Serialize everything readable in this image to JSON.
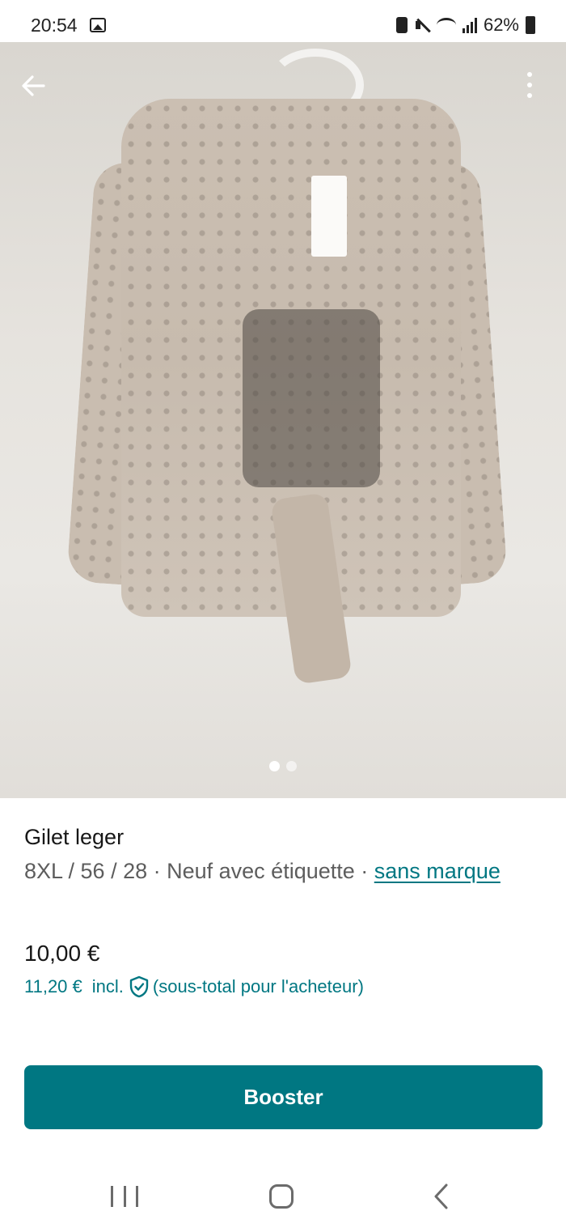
{
  "status_bar": {
    "time": "20:54",
    "battery": "62%",
    "icons": [
      "gallery-icon",
      "nfc-icon",
      "mute-icon",
      "wifi-icon",
      "signal-icon",
      "battery-icon"
    ]
  },
  "photo": {
    "pagination": {
      "count": 2,
      "active_index": 0
    }
  },
  "listing": {
    "title": "Gilet leger",
    "meta": "8XL / 56 / 28 · Neuf avec étiquette · ",
    "brand": "sans marque",
    "price": "10,00 €",
    "buyer_price": "11,20 €",
    "buyer_incl": "incl.",
    "buyer_note": "(sous-total pour l'acheteur)"
  },
  "actions": {
    "booster_label": "Booster"
  },
  "colors": {
    "accent": "#007782",
    "text": "#171717",
    "muted": "#5d5d5d"
  }
}
